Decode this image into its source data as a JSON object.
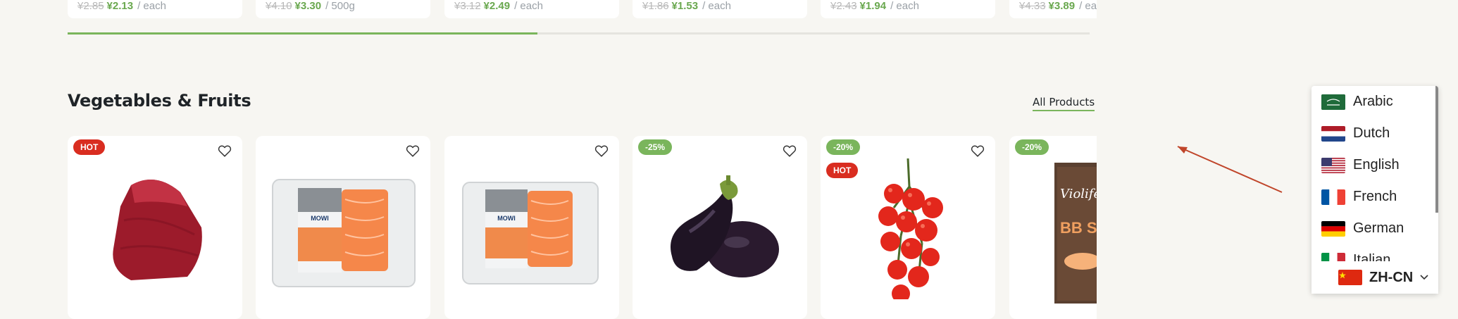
{
  "top_prices": [
    {
      "old": "¥2.85",
      "new": "¥2.13",
      "unit": "/ each"
    },
    {
      "old": "¥4.10",
      "new": "¥3.30",
      "unit": "/ 500g"
    },
    {
      "old": "¥3.12",
      "new": "¥2.49",
      "unit": "/ each"
    },
    {
      "old": "¥1.86",
      "new": "¥1.53",
      "unit": "/ each"
    },
    {
      "old": "¥2.43",
      "new": "¥1.94",
      "unit": "/ each"
    },
    {
      "old": "¥4.33",
      "new": "¥3.89",
      "unit": "/ ea"
    }
  ],
  "carousel_progress": 0.46,
  "section": {
    "title": "Vegetables & Fruits",
    "all_products_label": "All Products"
  },
  "products": [
    {
      "badges": [
        "HOT"
      ],
      "image": "tuna-steak"
    },
    {
      "badges": [],
      "image": "salmon-pack",
      "pack_brand": "MOWI"
    },
    {
      "badges": [],
      "image": "salmon-pack",
      "pack_brand": "MOWI"
    },
    {
      "badges": [
        "-25%"
      ],
      "image": "eggplant"
    },
    {
      "badges": [
        "-20%",
        "HOT"
      ],
      "image": "cherry-tomatoes"
    },
    {
      "badges": [
        "-20%"
      ],
      "image": "violife-slices",
      "pack_brand": "Violife",
      "pack_text": "BB SLIC"
    }
  ],
  "languages": [
    {
      "label": "Arabic",
      "flag": "saudi-arabia-flag"
    },
    {
      "label": "Dutch",
      "flag": "netherlands-flag"
    },
    {
      "label": "English",
      "flag": "usa-flag"
    },
    {
      "label": "French",
      "flag": "france-flag"
    },
    {
      "label": "German",
      "flag": "germany-flag"
    },
    {
      "label": "Italian",
      "flag": "italy-flag"
    }
  ],
  "selected_language": {
    "label": "ZH-CN",
    "flag": "china-flag"
  },
  "colors": {
    "accent": "#7ab55c",
    "hot": "#d92d20",
    "arrow": "#c0452a"
  }
}
